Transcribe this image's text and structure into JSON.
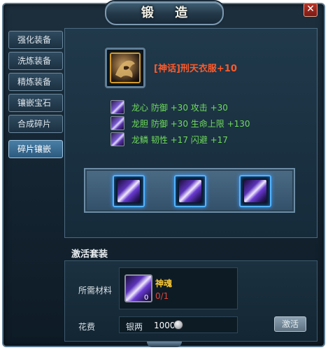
{
  "window": {
    "title": "锻 造",
    "close_icon": "close-icon"
  },
  "tabs": [
    {
      "label": "强化装备",
      "active": false
    },
    {
      "label": "洗炼装备",
      "active": false
    },
    {
      "label": "精炼装备",
      "active": false
    },
    {
      "label": "镶嵌宝石",
      "active": false
    },
    {
      "label": "合成碎片",
      "active": false
    },
    {
      "label": "碎片镶嵌",
      "active": true
    }
  ],
  "item": {
    "name": "[神话]刑天衣服+10",
    "name_color": "#ff5a2a",
    "icon": "armor-icon"
  },
  "stats": [
    {
      "text": "龙心  防御 +30  攻击 +30"
    },
    {
      "text": "龙胆  防御 +30  生命上限 +130"
    },
    {
      "text": "龙鳞  韧性 +17  闪避 +17"
    }
  ],
  "sockets": [
    {
      "icon": "purple-gem-icon"
    },
    {
      "icon": "purple-gem-icon"
    },
    {
      "icon": "purple-gem-icon"
    }
  ],
  "activate_set": {
    "section_title": "激活套装",
    "required_label": "所需材料",
    "material": {
      "name": "神魂",
      "qty": "0/1",
      "count": "0",
      "icon": "purple-gem-icon"
    },
    "cost_label": "花费",
    "currency": "银两",
    "cost_value": "1000",
    "coin_icon": "silver-coin-icon",
    "button_label": "激活"
  }
}
